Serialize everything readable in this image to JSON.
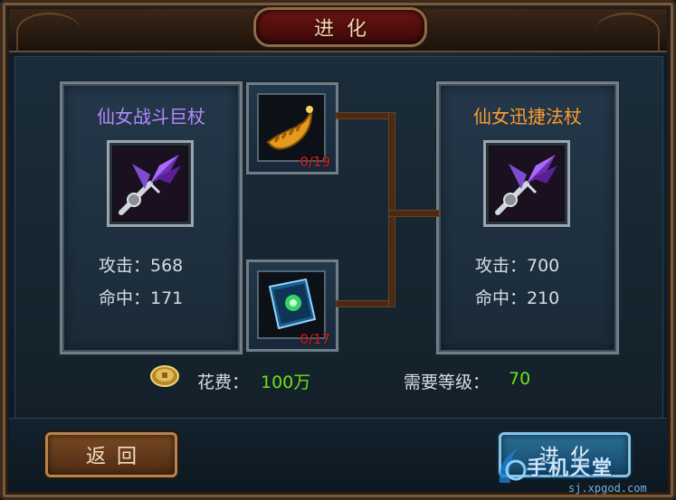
{
  "header": {
    "title": "进化"
  },
  "source_item": {
    "name": "仙女战斗巨杖",
    "stats": {
      "attack": "攻击：568",
      "hit": "命中：171"
    }
  },
  "target_item": {
    "name": "仙女迅捷法杖",
    "stats": {
      "attack": "攻击：700",
      "hit": "命中：210"
    }
  },
  "materials": [
    {
      "icon": "golden-horn-icon",
      "count": "0/19"
    },
    {
      "icon": "blue-rune-book-icon",
      "count": "0/17"
    }
  ],
  "requirements": {
    "cost_label": "花费：",
    "cost_value": "100万",
    "level_label": "需要等级：",
    "level_value": "70"
  },
  "buttons": {
    "back": "返回",
    "evolve": "进化"
  },
  "watermark": {
    "text": "手机天堂",
    "url": "sj.xpgod.com"
  },
  "colors": {
    "source_name": "#b687ff",
    "target_name": "#ff9d2f",
    "highlight_value": "#6ee11d",
    "material_count": "#e02020"
  }
}
